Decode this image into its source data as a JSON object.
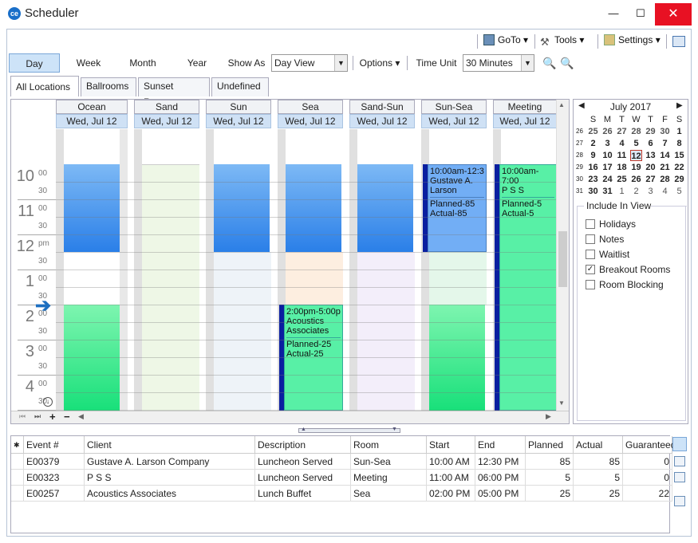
{
  "window": {
    "title": "Scheduler",
    "minimize": "—",
    "maximize": "☐",
    "close": "✕"
  },
  "toolbar": {
    "goto": "GoTo",
    "tools": "Tools",
    "settings": "Settings"
  },
  "viewbar": {
    "day": "Day",
    "week": "Week",
    "month": "Month",
    "year": "Year",
    "show_as_label": "Show As",
    "show_as_value": "Day View",
    "options": "Options",
    "time_unit_label": "Time Unit",
    "time_unit_value": "30 Minutes"
  },
  "tabs": [
    "All Locations",
    "Ballrooms",
    "Sunset Rooms",
    "Undefined"
  ],
  "rooms": [
    {
      "name": "Ocean",
      "date": "Wed, Jul 12"
    },
    {
      "name": "Sand",
      "date": "Wed, Jul 12"
    },
    {
      "name": "Sun",
      "date": "Wed, Jul 12"
    },
    {
      "name": "Sea",
      "date": "Wed, Jul 12"
    },
    {
      "name": "Sand-Sun",
      "date": "Wed, Jul 12"
    },
    {
      "name": "Sun-Sea",
      "date": "Wed, Jul 12"
    },
    {
      "name": "Meeting",
      "date": "Wed, Jul 12"
    }
  ],
  "hours": [
    {
      "h": "10",
      "m": "00",
      "m30": "30"
    },
    {
      "h": "11",
      "m": "00",
      "m30": "30"
    },
    {
      "h": "12",
      "m": "pm",
      "m30": "30"
    },
    {
      "h": "1",
      "m": "00",
      "m30": "30"
    },
    {
      "h": "2",
      "m": "00",
      "m30": "30"
    },
    {
      "h": "3",
      "m": "00",
      "m30": "30"
    },
    {
      "h": "4",
      "m": "00",
      "m30": "30"
    }
  ],
  "events": {
    "sunsea": {
      "time": "10:00am-12:3",
      "client": "Gustave A. Larson",
      "planned": "Planned-85",
      "actual": "Actual-85"
    },
    "meeting": {
      "time": "10:00am-7:00",
      "client": "P S S",
      "planned": "Planned-5",
      "actual": "Actual-5"
    },
    "sea": {
      "time": "2:00pm-5:00p",
      "client": "Acoustics Associates",
      "planned": "Planned-25",
      "actual": "Actual-25"
    }
  },
  "calendar": {
    "month": "July 2017",
    "weekdays": [
      "S",
      "M",
      "T",
      "W",
      "T",
      "F",
      "S"
    ],
    "weeks": [
      {
        "wk": "26",
        "days": [
          "25",
          "26",
          "27",
          "28",
          "29",
          "30",
          "1"
        ]
      },
      {
        "wk": "27",
        "days": [
          "2",
          "3",
          "4",
          "5",
          "6",
          "7",
          "8"
        ]
      },
      {
        "wk": "28",
        "days": [
          "9",
          "10",
          "11",
          "12",
          "13",
          "14",
          "15"
        ]
      },
      {
        "wk": "29",
        "days": [
          "16",
          "17",
          "18",
          "19",
          "20",
          "21",
          "22"
        ]
      },
      {
        "wk": "30",
        "days": [
          "23",
          "24",
          "25",
          "26",
          "27",
          "28",
          "29"
        ]
      },
      {
        "wk": "31",
        "days": [
          "30",
          "31",
          "1",
          "2",
          "3",
          "4",
          "5"
        ]
      }
    ]
  },
  "include": {
    "title": "Include In View",
    "items": [
      {
        "label": "Holidays",
        "checked": false
      },
      {
        "label": "Notes",
        "checked": false
      },
      {
        "label": "Waitlist",
        "checked": false
      },
      {
        "label": "Breakout Rooms",
        "checked": true
      },
      {
        "label": "Room Blocking",
        "checked": false
      }
    ]
  },
  "grid": {
    "marker": "✱",
    "columns": [
      "Event #",
      "Client",
      "Description",
      "Room",
      "Start",
      "End",
      "Planned",
      "Actual",
      "Guaranteed"
    ],
    "rows": [
      [
        "E00379",
        "Gustave A. Larson Company",
        "Luncheon Served",
        "Sun-Sea",
        "10:00 AM",
        "12:30 PM",
        "85",
        "85",
        "0"
      ],
      [
        "E00323",
        "P S S",
        "Luncheon Served",
        "Meeting",
        "11:00 AM",
        "06:00 PM",
        "5",
        "5",
        "0"
      ],
      [
        "E00257",
        "Acoustics Associates",
        "Lunch Buffet",
        "Sea",
        "02:00 PM",
        "05:00 PM",
        "25",
        "25",
        "22"
      ]
    ]
  }
}
